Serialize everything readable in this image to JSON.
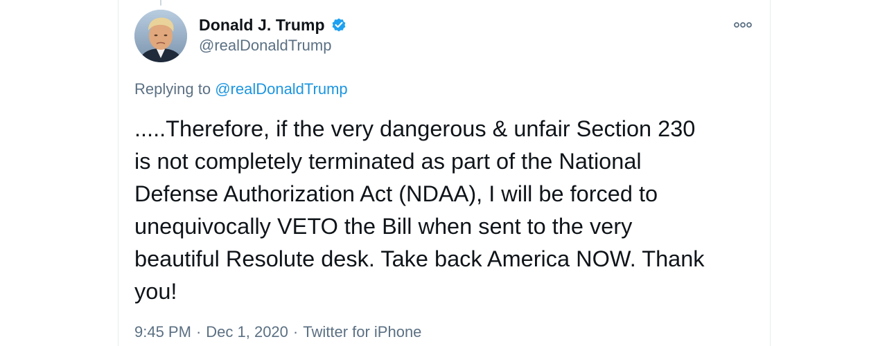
{
  "tweet": {
    "author": {
      "display_name": "Donald J. Trump",
      "handle": "@realDonaldTrump",
      "verified": true,
      "avatar_icon": "profile-photo"
    },
    "replying_to": {
      "prefix": "Replying to ",
      "mention": "@realDonaldTrump"
    },
    "text": ".....Therefore, if the very dangerous & unfair Section 230\nis not completely terminated as part of the National\nDefense Authorization Act (NDAA), I will be forced to\nunequivocally VETO the Bill when sent to the very\nbeautiful Resolute desk. Take back America NOW. Thank\nyou!",
    "meta": {
      "time": "9:45 PM",
      "date": "Dec 1, 2020",
      "source": "Twitter for iPhone",
      "separator": "·"
    },
    "more_icon": "more-options-icon"
  },
  "colors": {
    "text_primary": "#0f1419",
    "text_secondary": "#5b7083",
    "link": "#1b95e0",
    "verified_badge": "#1da1f2"
  }
}
